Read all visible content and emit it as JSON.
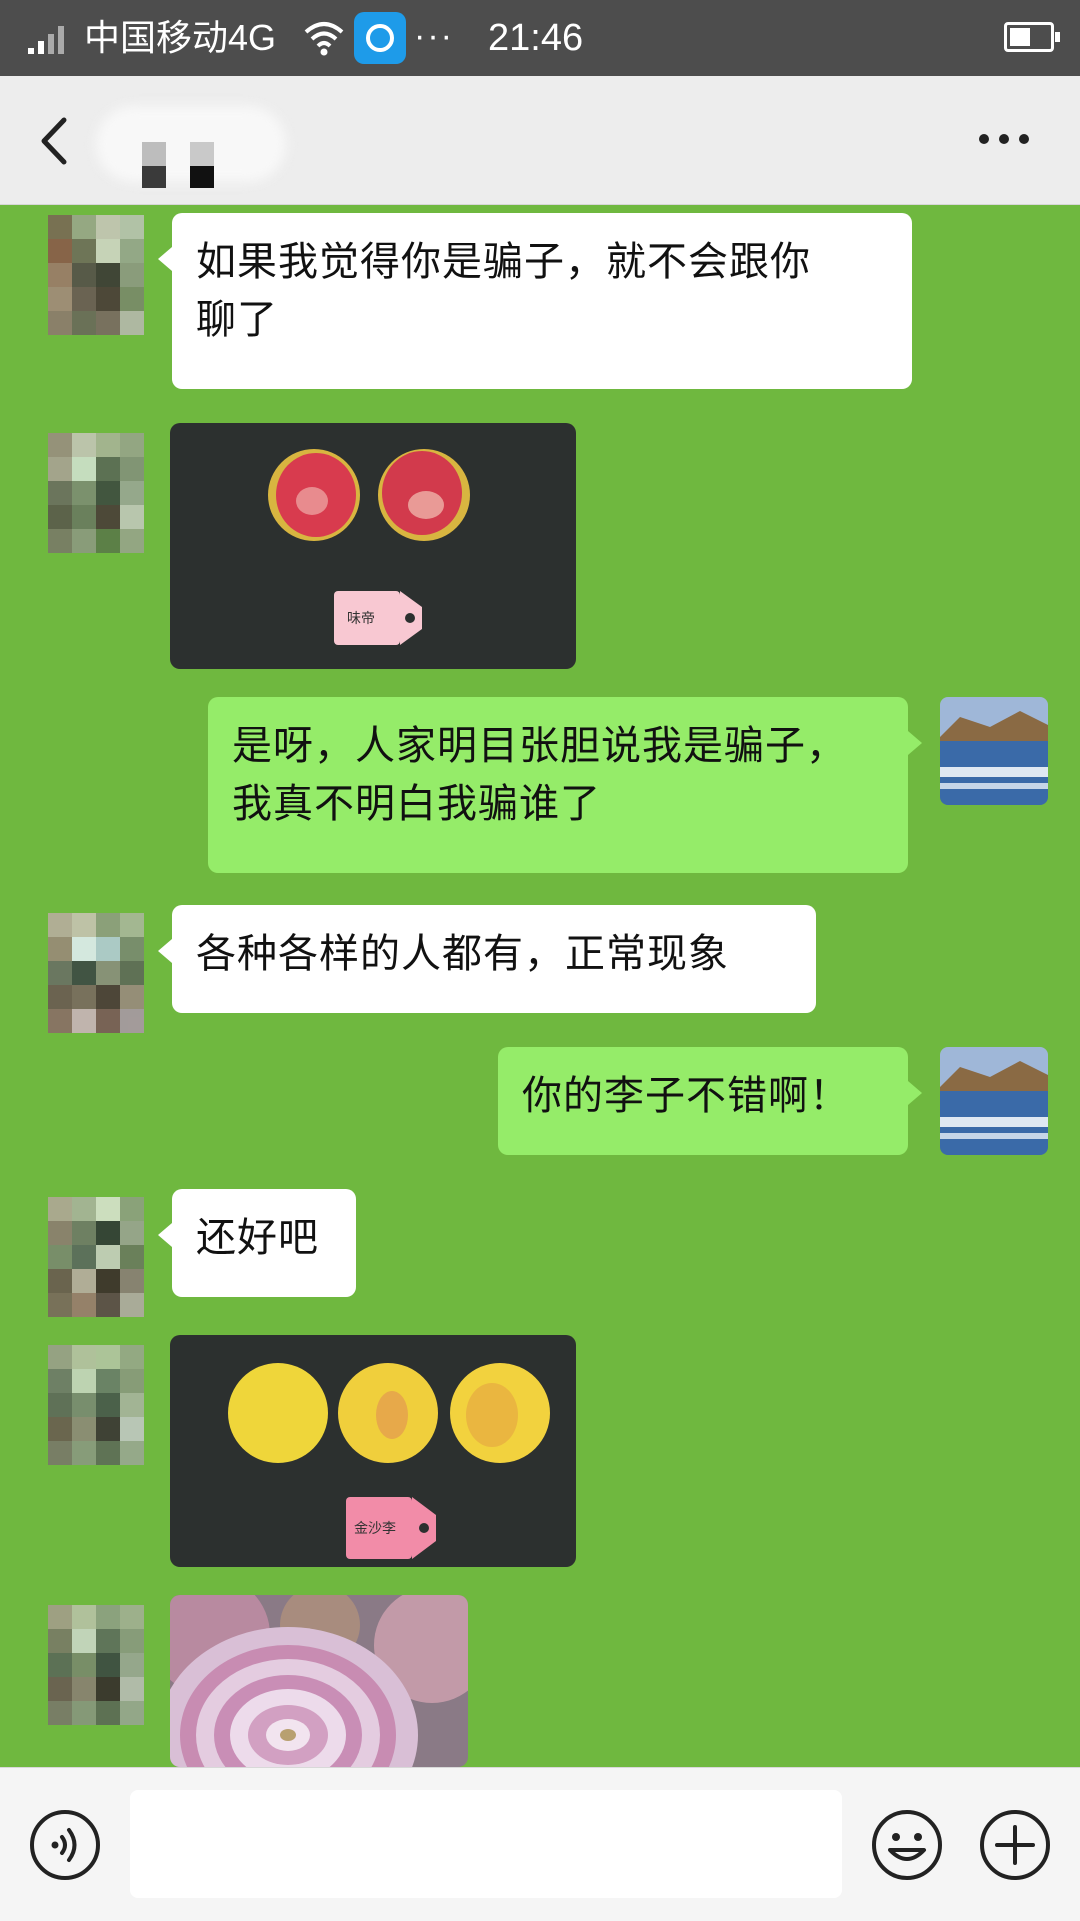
{
  "status_bar": {
    "carrier": "中国移动4G",
    "more": "···",
    "time": "21:46"
  },
  "header": {
    "more_icon": "more-dots-icon",
    "back_icon": "back-chevron-icon"
  },
  "messages": [
    {
      "from": "them",
      "type": "text",
      "text_line1": "如果我觉得你是骗子，就不会跟你",
      "text_line2": "聊了"
    },
    {
      "from": "them",
      "type": "image",
      "tag_text": "味帝"
    },
    {
      "from": "me",
      "type": "text",
      "text_line1": "是呀，人家明目张胆说我是骗子，",
      "text_line2": "我真不明白我骗谁了"
    },
    {
      "from": "them",
      "type": "text",
      "text_line1": "各种各样的人都有，正常现象"
    },
    {
      "from": "me",
      "type": "text",
      "text_line1": "你的李子不错啊！"
    },
    {
      "from": "them",
      "type": "text",
      "text_line1": "还好吧"
    },
    {
      "from": "them",
      "type": "image",
      "tag_text": "金沙李"
    },
    {
      "from": "them",
      "type": "image"
    }
  ],
  "input_bar": {
    "voice_icon": "voice-icon",
    "emoji_icon": "emoji-icon",
    "plus_icon": "plus-icon",
    "placeholder": ""
  },
  "colors": {
    "chat_background": "#6fb83f",
    "outgoing_bubble": "#95ec69",
    "incoming_bubble": "#ffffff"
  }
}
